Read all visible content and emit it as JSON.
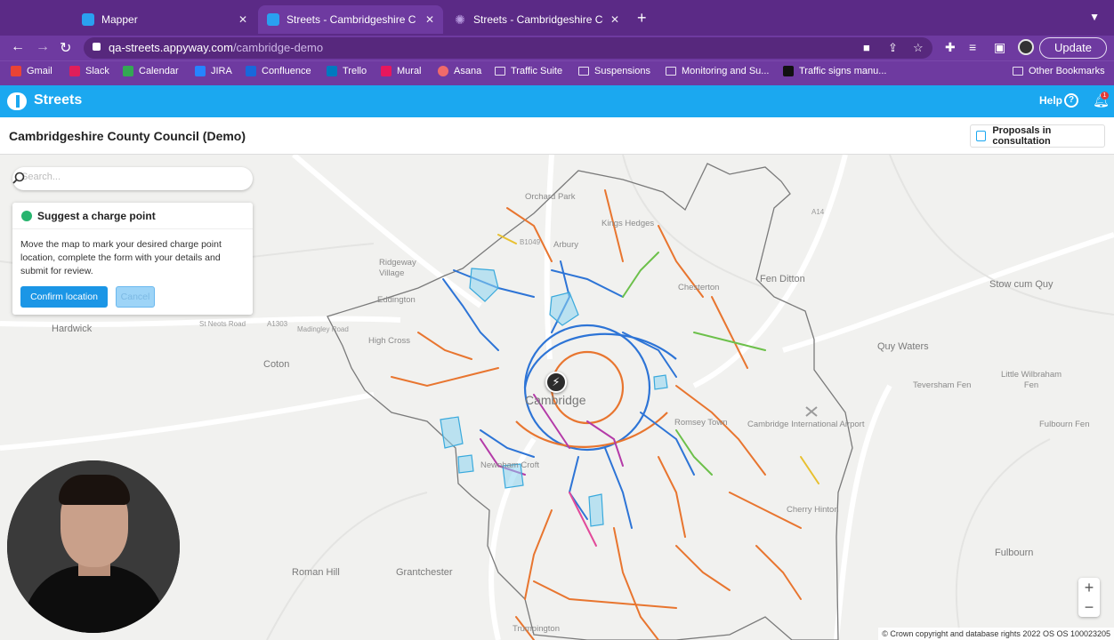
{
  "browser": {
    "tabs": [
      {
        "title": "Mapper",
        "active": false
      },
      {
        "title": "Streets - Cambridgeshire C",
        "active": true
      },
      {
        "title": "Streets - Cambridgeshire Counc",
        "active": false
      }
    ],
    "url_domain": "qa-streets.appyway.com",
    "url_path": "/cambridge-demo",
    "update_label": "Update",
    "bookmarks": [
      "Gmail",
      "Slack",
      "Calendar",
      "JIRA",
      "Confluence",
      "Trello",
      "Mural",
      "Asana",
      "Traffic Suite",
      "Suspensions",
      "Monitoring and Su...",
      "Traffic signs manu...",
      "Other Bookmarks"
    ]
  },
  "app": {
    "name": "Streets",
    "help_label": "Help",
    "notification_count": "1",
    "council_title": "Cambridgeshire County Council (Demo)",
    "proposals_label": "Proposals in consultation",
    "accent_color": "#1ba8f0"
  },
  "search": {
    "placeholder": "Search..."
  },
  "panel": {
    "title": "Suggest a charge point",
    "description": "Move the map to mark your desired charge point location, complete the form with your details and submit for review.",
    "confirm_label": "Confirm location",
    "cancel_label": "Cancel"
  },
  "map": {
    "places": [
      "Orchard Park",
      "Kings Hedges",
      "Arbury",
      "Chesterton",
      "Fen Ditton",
      "Stow cum Quy",
      "Ridgeway Village",
      "Eddington",
      "Hardwick",
      "High Cross",
      "Coton",
      "Quy Waters",
      "Teversham Fen",
      "Little Wilbraham Fen",
      "Cambridge",
      "Romsey Town",
      "Cambridge International Airport",
      "Newnham Croft",
      "Cherry Hinton",
      "Fulbourn Fen",
      "Roman Hill",
      "Grantchester",
      "Fulbourn",
      "Trumpington",
      "A1303",
      "St Neots Road",
      "Madingley Road",
      "B1049",
      "A14"
    ],
    "zoom_in": "+",
    "zoom_out": "−",
    "copyright": "© Crown copyright and database rights 2022 OS OS 100023205"
  }
}
